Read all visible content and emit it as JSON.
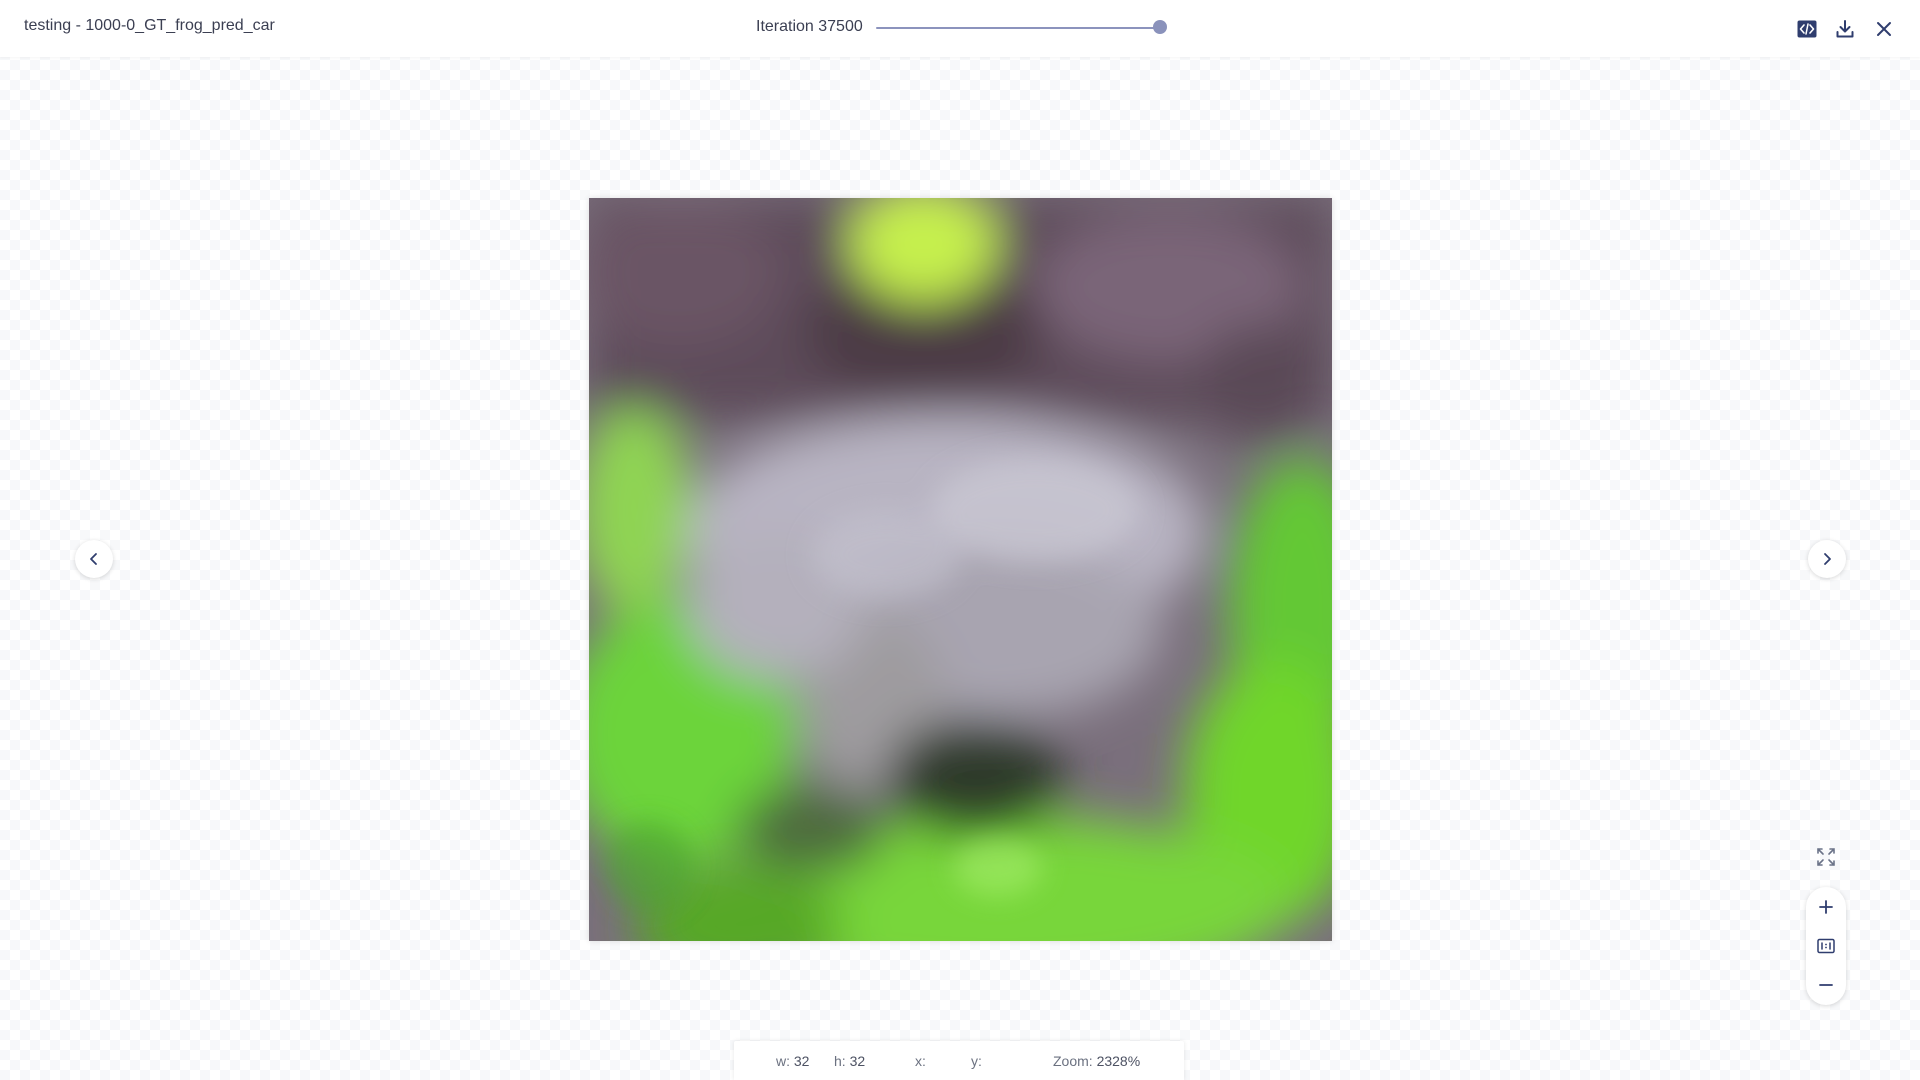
{
  "header": {
    "title": "testing - 1000-0_GT_frog_pred_car",
    "iteration_label": "Iteration 37500",
    "slider_value": 1.0
  },
  "toolbar": {
    "icons": [
      "code-embed-icon",
      "download-icon",
      "close-icon"
    ]
  },
  "navigation": {
    "prev_icon": "chevron-left-icon",
    "next_icon": "chevron-right-icon"
  },
  "zoom_controls": {
    "icons": [
      "fit-screen-icon",
      "zoom-in-icon",
      "actual-size-icon",
      "zoom-out-icon"
    ]
  },
  "status": {
    "w_label": "w:",
    "w_value": "32",
    "h_label": "h:",
    "h_value": "32",
    "x_label": "x:",
    "x_value": "",
    "y_label": "y:",
    "y_value": "",
    "zoom_label": "Zoom:",
    "zoom_value": "2328%"
  },
  "colors": {
    "accent": "#8a92bb",
    "text": "#3b3f52",
    "icon": "#2f3d6e"
  }
}
